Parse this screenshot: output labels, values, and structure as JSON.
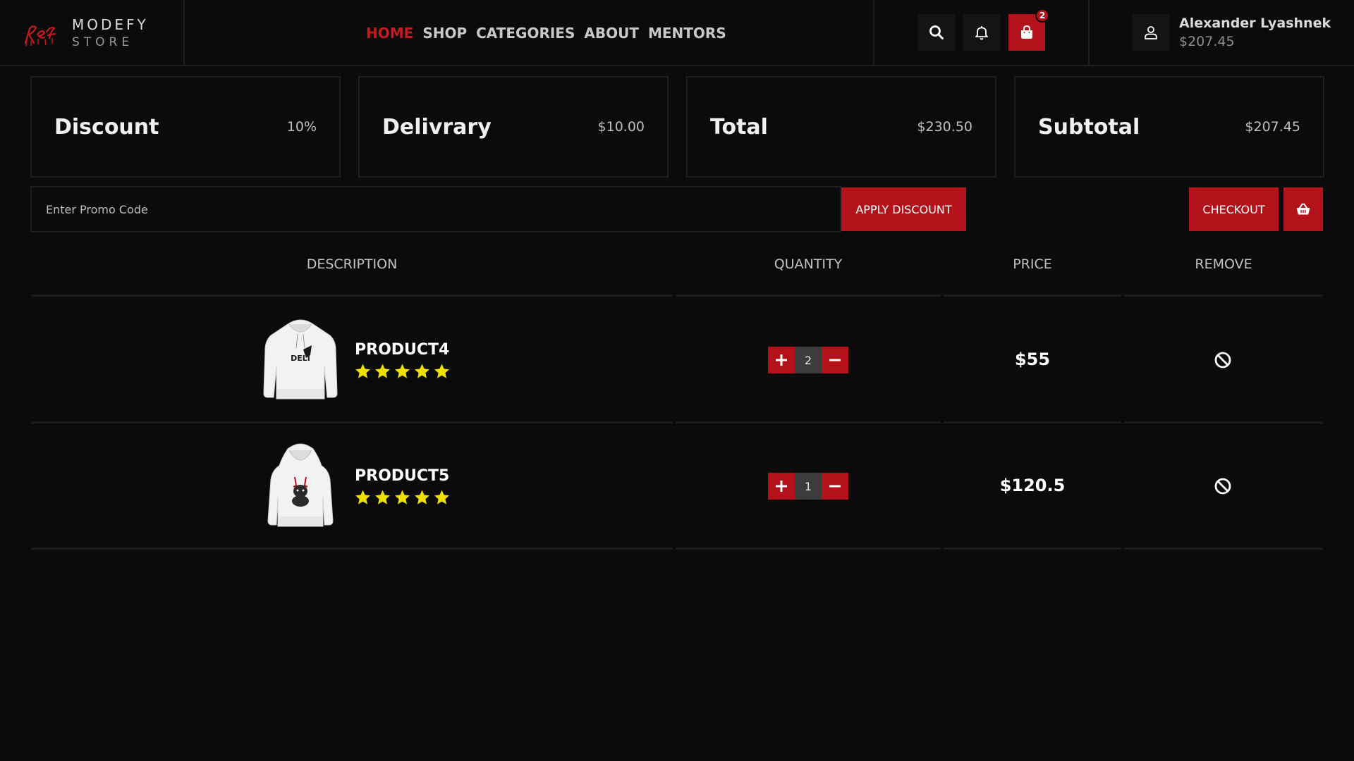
{
  "brand": {
    "name": "MODEFY",
    "subtitle": "STORE"
  },
  "nav": {
    "items": [
      "HOME",
      "SHOP",
      "CATEGORIES",
      "ABOUT",
      "MENTORS"
    ],
    "active": "HOME"
  },
  "header": {
    "cart_count": "2"
  },
  "user": {
    "name": "Alexander Lyashnek",
    "balance": "$207.45"
  },
  "summary": [
    {
      "label": "Discount",
      "value": "10%"
    },
    {
      "label": "Delivrary",
      "value": "$10.00"
    },
    {
      "label": "Total",
      "value": "$230.50"
    },
    {
      "label": "Subtotal",
      "value": "$207.45"
    }
  ],
  "promo": {
    "placeholder": "Enter Promo Code",
    "apply_label": "APPLY DISCOUNT",
    "checkout_label": "CHECKOUT"
  },
  "table": {
    "headers": {
      "description": "DESCRIPTION",
      "quantity": "QUANTITY",
      "price": "PRICE",
      "remove": "REMOVE"
    },
    "rows": [
      {
        "name": "PRODUCT4",
        "rating": 5,
        "quantity": "2",
        "price": "$55"
      },
      {
        "name": "PRODUCT5",
        "rating": 5,
        "quantity": "1",
        "price": "$120.5"
      }
    ]
  },
  "colors": {
    "accent": "#b3121a",
    "accent_text": "#c8191e",
    "star": "#f0e000",
    "background": "#0b0b0b"
  },
  "icons": [
    "logo-icon",
    "search-icon",
    "bell-icon",
    "shopping-bag-icon",
    "user-icon",
    "basket-icon",
    "plus-icon",
    "minus-icon",
    "remove-icon",
    "star-icon",
    "hoodie-image"
  ]
}
